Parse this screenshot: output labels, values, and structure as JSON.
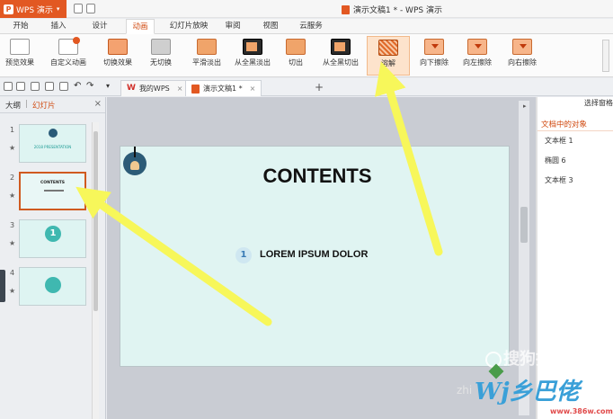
{
  "app": {
    "name": "WPS 演示",
    "logo_letter": "P",
    "doc_title": "演示文稿1 * - WPS 演示"
  },
  "tabs": [
    "开始",
    "插入",
    "设计",
    "动画",
    "幻灯片放映",
    "审阅",
    "视图",
    "云服务"
  ],
  "active_tab": "动画",
  "ribbon": {
    "preview": "预览效果",
    "custom": "自定义动画",
    "switch": "切换效果",
    "none": "无切换",
    "smooth": "平滑淡出",
    "fade_black": "从全黑淡出",
    "cut": "切出",
    "cut_black": "从全黑切出",
    "dissolve": "溶解",
    "wipe_down": "向下擦除",
    "wipe_left": "向左擦除",
    "wipe_right": "向右擦除"
  },
  "doc_tabs": [
    {
      "label": "我的WPS",
      "icon": "W"
    },
    {
      "label": "演示文稿1 *"
    }
  ],
  "left_panel": {
    "tab_outline": "大纲",
    "tab_slides": "幻灯片",
    "slides": [
      {
        "num": "1",
        "title": "",
        "text": "2018\nPRESENTATION"
      },
      {
        "num": "2",
        "title": "CONTENTS"
      },
      {
        "num": "3",
        "title": "",
        "text": "1"
      },
      {
        "num": "4",
        "title": ""
      }
    ]
  },
  "slide": {
    "title": "CONTENTS",
    "item_num": "1",
    "item_text": "LOREM IPSUM DOLOR"
  },
  "right_panel": {
    "header": "选择窗格",
    "section": "文档中的对象",
    "items": [
      "文本框 1",
      "椭圆 6",
      "文本框 3"
    ]
  },
  "watermarks": {
    "sogou": "搜狗指南",
    "zhi": "zhi",
    "brand": "Wj乡巴佬",
    "url": "www.386w.com"
  },
  "colors": {
    "accent": "#e25822",
    "arrow": "#f7f75a",
    "slide_bg": "#e0f4f2"
  }
}
